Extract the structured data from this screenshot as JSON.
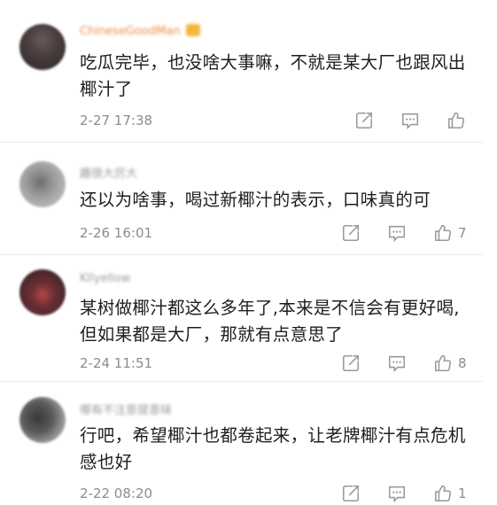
{
  "colors": {
    "accent": "#f08a3c",
    "text": "#1e1e1e",
    "muted": "#8c8c8c",
    "icon": "#9a9a9a"
  },
  "comments": [
    {
      "username": "ChineseGoodMan",
      "vip": true,
      "text": "吃瓜完毕，也没啥大事嘛，不就是某大厂也跟风出椰汁了",
      "time": "2-27 17:38",
      "likes": ""
    },
    {
      "username": "趣很大厉大",
      "vip": false,
      "text": "还以为啥事，喝过新椰汁的表示，口味真的可",
      "time": "2-26 16:01",
      "likes": "7"
    },
    {
      "username": "Kllyellow",
      "vip": false,
      "text": "某树做椰汁都这么多年了,本来是不信会有更好喝,但如果都是大厂，那就有点意思了",
      "time": "2-24 11:51",
      "likes": "8"
    },
    {
      "username": "哪有不注意提意味",
      "vip": false,
      "text": "行吧，希望椰汁也都卷起来，让老牌椰汁有点危机感也好",
      "time": "2-22 08:20",
      "likes": "1"
    }
  ]
}
